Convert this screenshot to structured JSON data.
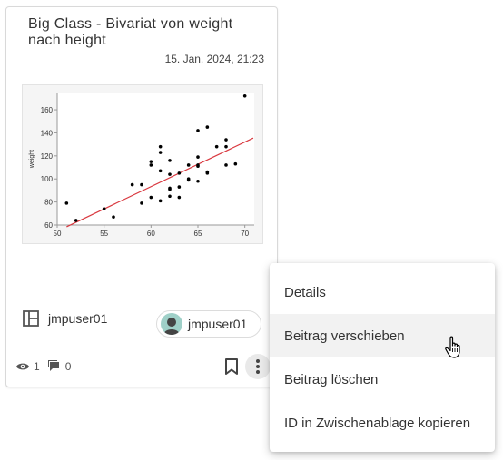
{
  "card": {
    "title": "Big Class - Bivariat von weight nach height",
    "date": "15. Jan. 2024, 21:23",
    "owner": "jmpuser01",
    "user_chip": "jmpuser01",
    "views": "1",
    "comments": "0"
  },
  "chart_data": {
    "type": "scatter",
    "ylabel": "weight",
    "xlim": [
      50,
      71
    ],
    "ylim": [
      60,
      175
    ],
    "x_ticks": [
      "50",
      "55",
      "60",
      "65",
      "70"
    ],
    "y_ticks": [
      "60",
      "80",
      "100",
      "120",
      "140",
      "160"
    ],
    "points": [
      [
        51,
        79
      ],
      [
        52,
        64
      ],
      [
        55,
        74
      ],
      [
        56,
        67
      ],
      [
        58,
        95
      ],
      [
        59,
        95
      ],
      [
        59,
        79
      ],
      [
        60,
        112
      ],
      [
        60,
        115
      ],
      [
        60,
        84
      ],
      [
        61,
        128
      ],
      [
        61,
        123
      ],
      [
        61,
        107
      ],
      [
        61,
        81
      ],
      [
        62,
        116
      ],
      [
        62,
        104
      ],
      [
        62,
        92
      ],
      [
        62,
        91
      ],
      [
        62,
        85
      ],
      [
        63,
        105
      ],
      [
        63,
        93
      ],
      [
        63,
        84
      ],
      [
        64,
        112
      ],
      [
        64,
        100
      ],
      [
        64,
        99
      ],
      [
        65,
        142
      ],
      [
        65,
        119
      ],
      [
        65,
        112
      ],
      [
        65,
        111
      ],
      [
        65,
        98
      ],
      [
        66,
        145
      ],
      [
        66,
        106
      ],
      [
        66,
        105
      ],
      [
        67,
        128
      ],
      [
        68,
        134
      ],
      [
        68,
        128
      ],
      [
        68,
        112
      ],
      [
        69,
        113
      ],
      [
        70,
        172
      ]
    ],
    "fit_line": {
      "x": [
        51,
        70.9
      ],
      "y": [
        58.5,
        135.5
      ]
    },
    "colors": {
      "points": "#000000",
      "fit_line": "#d9383f"
    }
  },
  "menu": {
    "items": [
      "Details",
      "Beitrag verschieben",
      "Beitrag löschen",
      "ID in Zwischenablage kopieren"
    ],
    "hovered_index": 1
  }
}
